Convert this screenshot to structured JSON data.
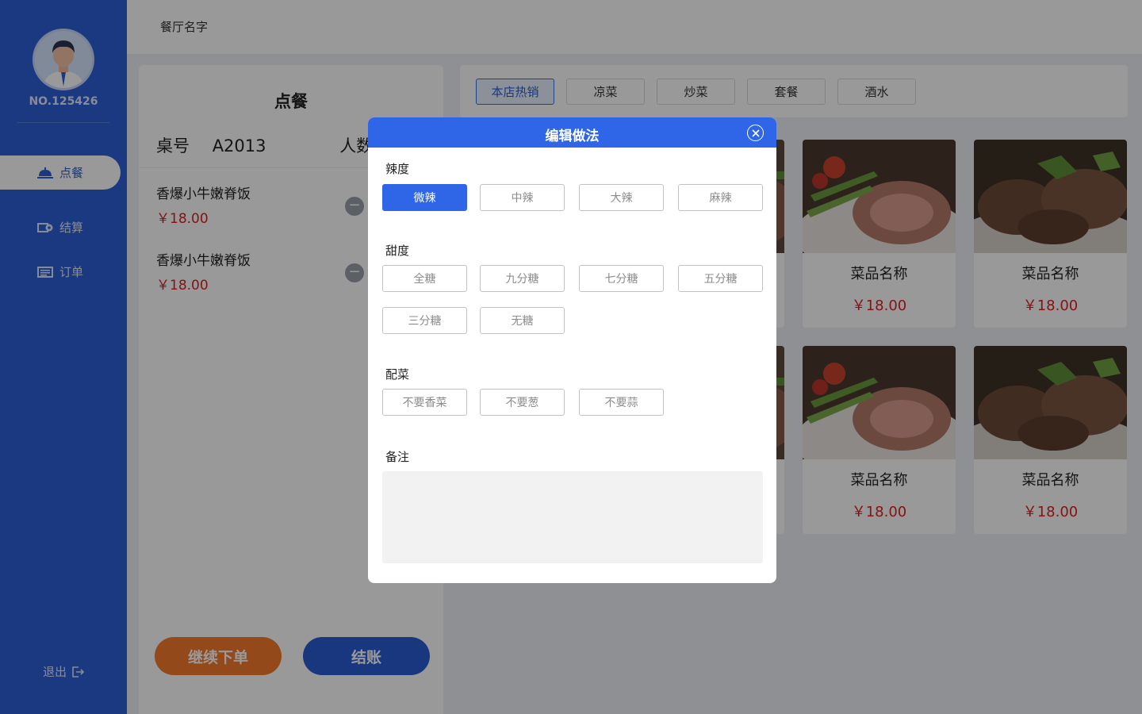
{
  "sidebar": {
    "user_id": "NO.125426",
    "nav": [
      {
        "label": "点餐",
        "icon": "service-bell-icon",
        "active": true
      },
      {
        "label": "结算",
        "icon": "cash-icon",
        "active": false
      },
      {
        "label": "订单",
        "icon": "receipt-icon",
        "active": false
      }
    ],
    "logout": "退出"
  },
  "header": {
    "restaurant_name": "餐厅名字"
  },
  "order": {
    "title": "点餐",
    "table_label": "桌号",
    "table_no": "A2013",
    "people_label": "人数",
    "items": [
      {
        "name": "香爆小牛嫩脊饭",
        "price": "￥18.00"
      },
      {
        "name": "香爆小牛嫩脊饭",
        "price": "￥18.00"
      }
    ],
    "continue_label": "继续下单",
    "checkout_label": "结账"
  },
  "menu": {
    "categories": [
      {
        "label": "本店热销",
        "active": true
      },
      {
        "label": "凉菜",
        "active": false
      },
      {
        "label": "炒菜",
        "active": false
      },
      {
        "label": "套餐",
        "active": false
      },
      {
        "label": "酒水",
        "active": false
      }
    ],
    "dishes": [
      {
        "name": "菜品名称",
        "price": "￥18.00"
      },
      {
        "name": "菜品名称",
        "price": "￥18.00"
      },
      {
        "name": "菜品名称",
        "price": "￥18.00"
      },
      {
        "name": "菜品名称",
        "price": "￥18.00"
      }
    ]
  },
  "modal": {
    "title": "编辑做法",
    "spice_label": "辣度",
    "spice_options": [
      "微辣",
      "中辣",
      "大辣",
      "麻辣"
    ],
    "spice_selected": "微辣",
    "sweet_label": "甜度",
    "sweet_options": [
      "全糖",
      "九分糖",
      "七分糖",
      "五分糖",
      "三分糖",
      "无糖"
    ],
    "side_label": "配菜",
    "side_options": [
      "不要香菜",
      "不要葱",
      "不要蒜"
    ],
    "remark_label": "备注",
    "remark_value": ""
  },
  "colors": {
    "sidebar": "#2d5fd6",
    "primary": "#2f66e8",
    "price": "#e01e1e",
    "continue": "#f57a2c"
  }
}
